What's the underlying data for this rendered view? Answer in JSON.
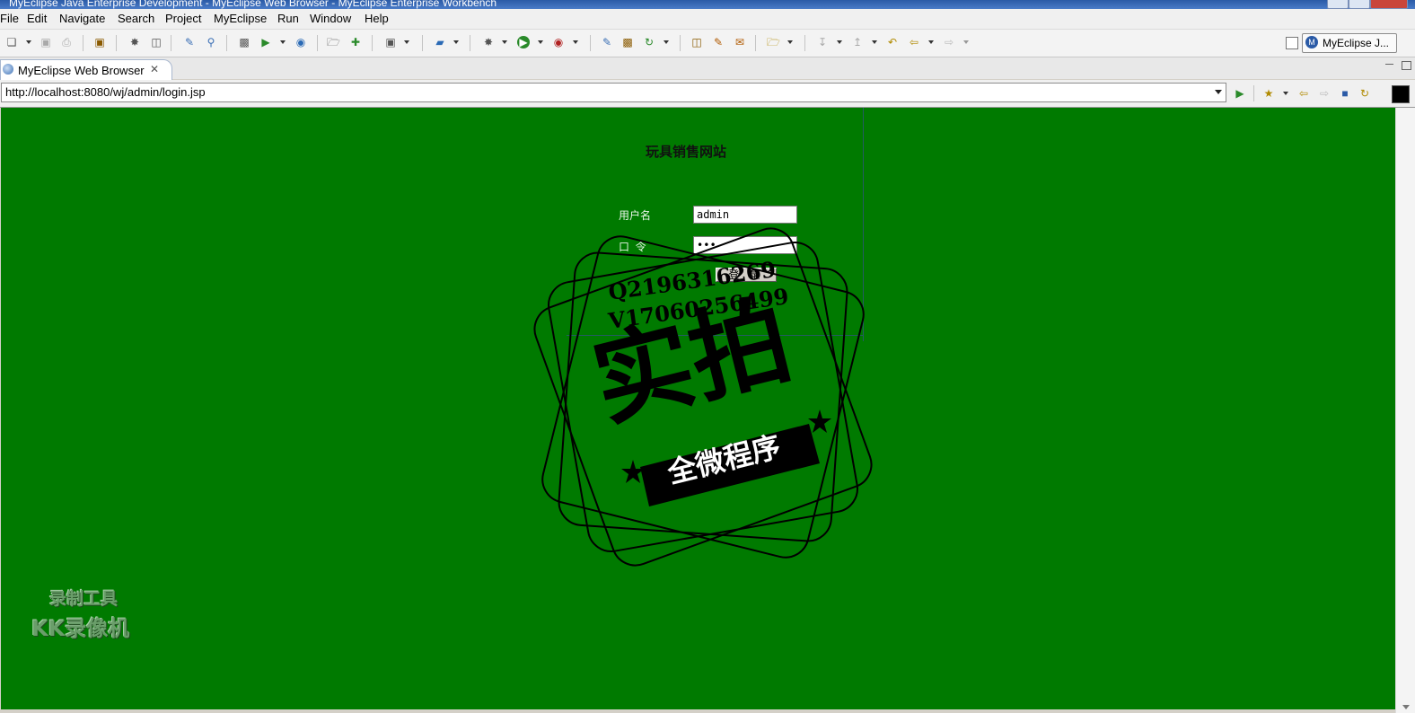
{
  "window": {
    "title": "MyEclipse Java Enterprise Development - MyEclipse Web Browser - MyEclipse Enterprise Workbench"
  },
  "menu": [
    "File",
    "Edit",
    "Navigate",
    "Search",
    "Project",
    "MyEclipse",
    "Run",
    "Window",
    "Help"
  ],
  "perspective": {
    "label": "MyEclipse J..."
  },
  "tab": {
    "label": "MyEclipse Web Browser"
  },
  "address": {
    "url": "http://localhost:8080/wj/admin/login.jsp"
  },
  "page": {
    "bg_color": "#007a00",
    "title": "玩具销售网站",
    "username_label": "用户名",
    "username_value": "admin",
    "password_label": "口  令",
    "password_value": "•••",
    "login_button": "登 录"
  },
  "stamp": {
    "line1": "Q2196316269",
    "line2": "V17060256499",
    "big_text": "实拍",
    "banner_text": "全微程序"
  },
  "watermark": {
    "line1": "录制工具",
    "line2": "KK录像机"
  }
}
